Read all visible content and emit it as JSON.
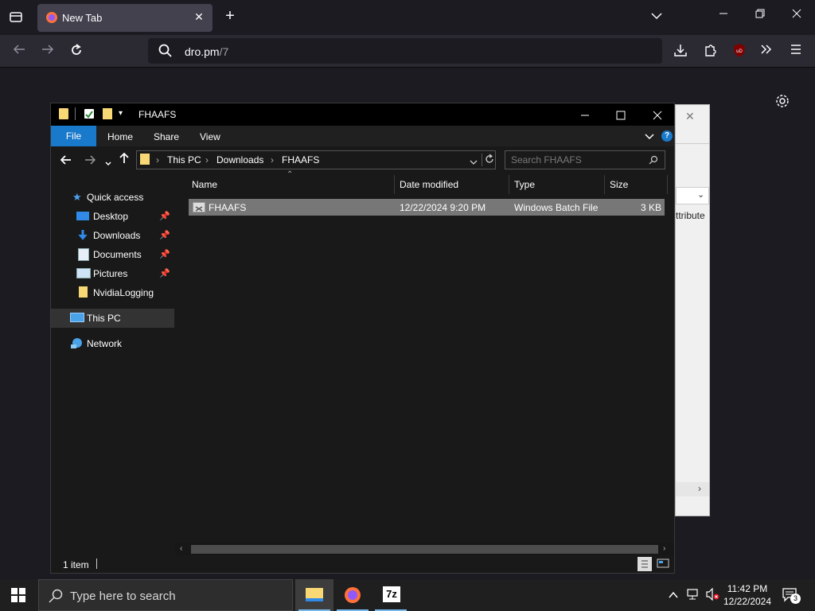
{
  "browser": {
    "tab_title": "New Tab",
    "url_host": "dro.pm",
    "url_path": "/7",
    "ublock_badge": "uD"
  },
  "background_dialog": {
    "text_fragment": "ttribute"
  },
  "explorer": {
    "title": "FHAAFS",
    "ribbon_tabs": [
      "File",
      "Home",
      "Share",
      "View"
    ],
    "breadcrumb": [
      "This PC",
      "Downloads",
      "FHAAFS"
    ],
    "search_placeholder": "Search FHAAFS",
    "columns": [
      "Name",
      "Date modified",
      "Type",
      "Size"
    ],
    "nav": {
      "quick_access": "Quick access",
      "desktop": "Desktop",
      "downloads": "Downloads",
      "documents": "Documents",
      "pictures": "Pictures",
      "nvidia": "NvidiaLogging",
      "this_pc": "This PC",
      "network": "Network"
    },
    "files": [
      {
        "name": "FHAAFS",
        "date": "12/22/2024 9:20 PM",
        "type": "Windows Batch File",
        "size": "3 KB"
      }
    ],
    "status": "1 item"
  },
  "taskbar": {
    "search_placeholder": "Type here to search",
    "time": "11:42 PM",
    "date": "12/22/2024",
    "notification_count": "3",
    "seven_zip_label": "7z"
  },
  "colors": {
    "accent": "#1979ca",
    "selection": "#777777",
    "taskbar_underline": "#76b9ed"
  }
}
